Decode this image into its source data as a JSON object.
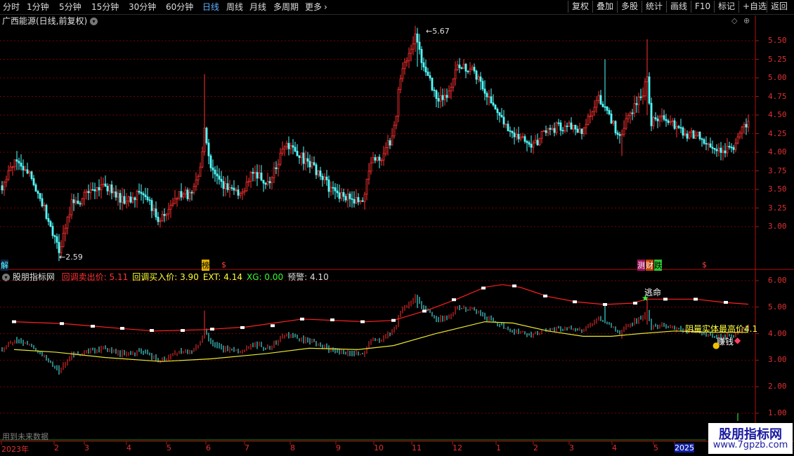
{
  "toolbar": {
    "periods": [
      "分时",
      "1分钟",
      "5分钟",
      "15分钟",
      "30分钟",
      "60分钟",
      "日线",
      "周线",
      "月线",
      "多周期",
      "更多"
    ],
    "more_arrow": "›",
    "actions": [
      "复权",
      "叠加",
      "多股",
      "统计",
      "画线",
      "F10",
      "标记",
      "+自选",
      "返回"
    ]
  },
  "main_panel": {
    "title": "广西能源(日线,前复权)",
    "high_label": "5.67",
    "low_label": "2.59",
    "y_ticks": [
      "5.50",
      "5.25",
      "5.00",
      "4.75",
      "4.50",
      "4.25",
      "4.00",
      "3.75",
      "3.50",
      "3.25",
      "3.00"
    ],
    "markers": [
      "解",
      "榜",
      "$",
      "测",
      "财",
      "跌",
      "$"
    ]
  },
  "indicator_panel": {
    "name": "股朋指标网",
    "params": [
      {
        "label": "回调卖出价:",
        "value": "5.11",
        "color": "#ff3333"
      },
      {
        "label": "回调买入价:",
        "value": "3.90",
        "color": "#ffff33"
      },
      {
        "label": "EXT:",
        "value": "4.14",
        "color": "#ffff33"
      },
      {
        "label": "XG:",
        "value": "0.00",
        "color": "#33ff33"
      },
      {
        "label": "预警:",
        "value": "4.10",
        "color": "#dddddd"
      }
    ],
    "y_ticks": [
      "6.00",
      "5.00",
      "4.00",
      "3.00",
      "2.00",
      "1.00"
    ],
    "annotations": {
      "escape": "逃命",
      "top_price": "阴量实体最高价4.1",
      "earn": "赚钱"
    },
    "future_note": "用到未来数据"
  },
  "x_axis": {
    "labels": [
      "2023年",
      "2",
      "3",
      "4",
      "5",
      "6",
      "7",
      "8",
      "9",
      "10",
      "11",
      "12",
      "1",
      "2",
      "3",
      "4",
      "5",
      "2025"
    ]
  },
  "watermark": {
    "name": "股朋指标网",
    "url": "www.7gpzb.com"
  },
  "colors": {
    "up": "#ff3030",
    "down": "#54ffff",
    "grid": "#7a0000",
    "border": "#b01010",
    "sell_line": "#ff2020",
    "buy_line": "#e8e830"
  }
}
